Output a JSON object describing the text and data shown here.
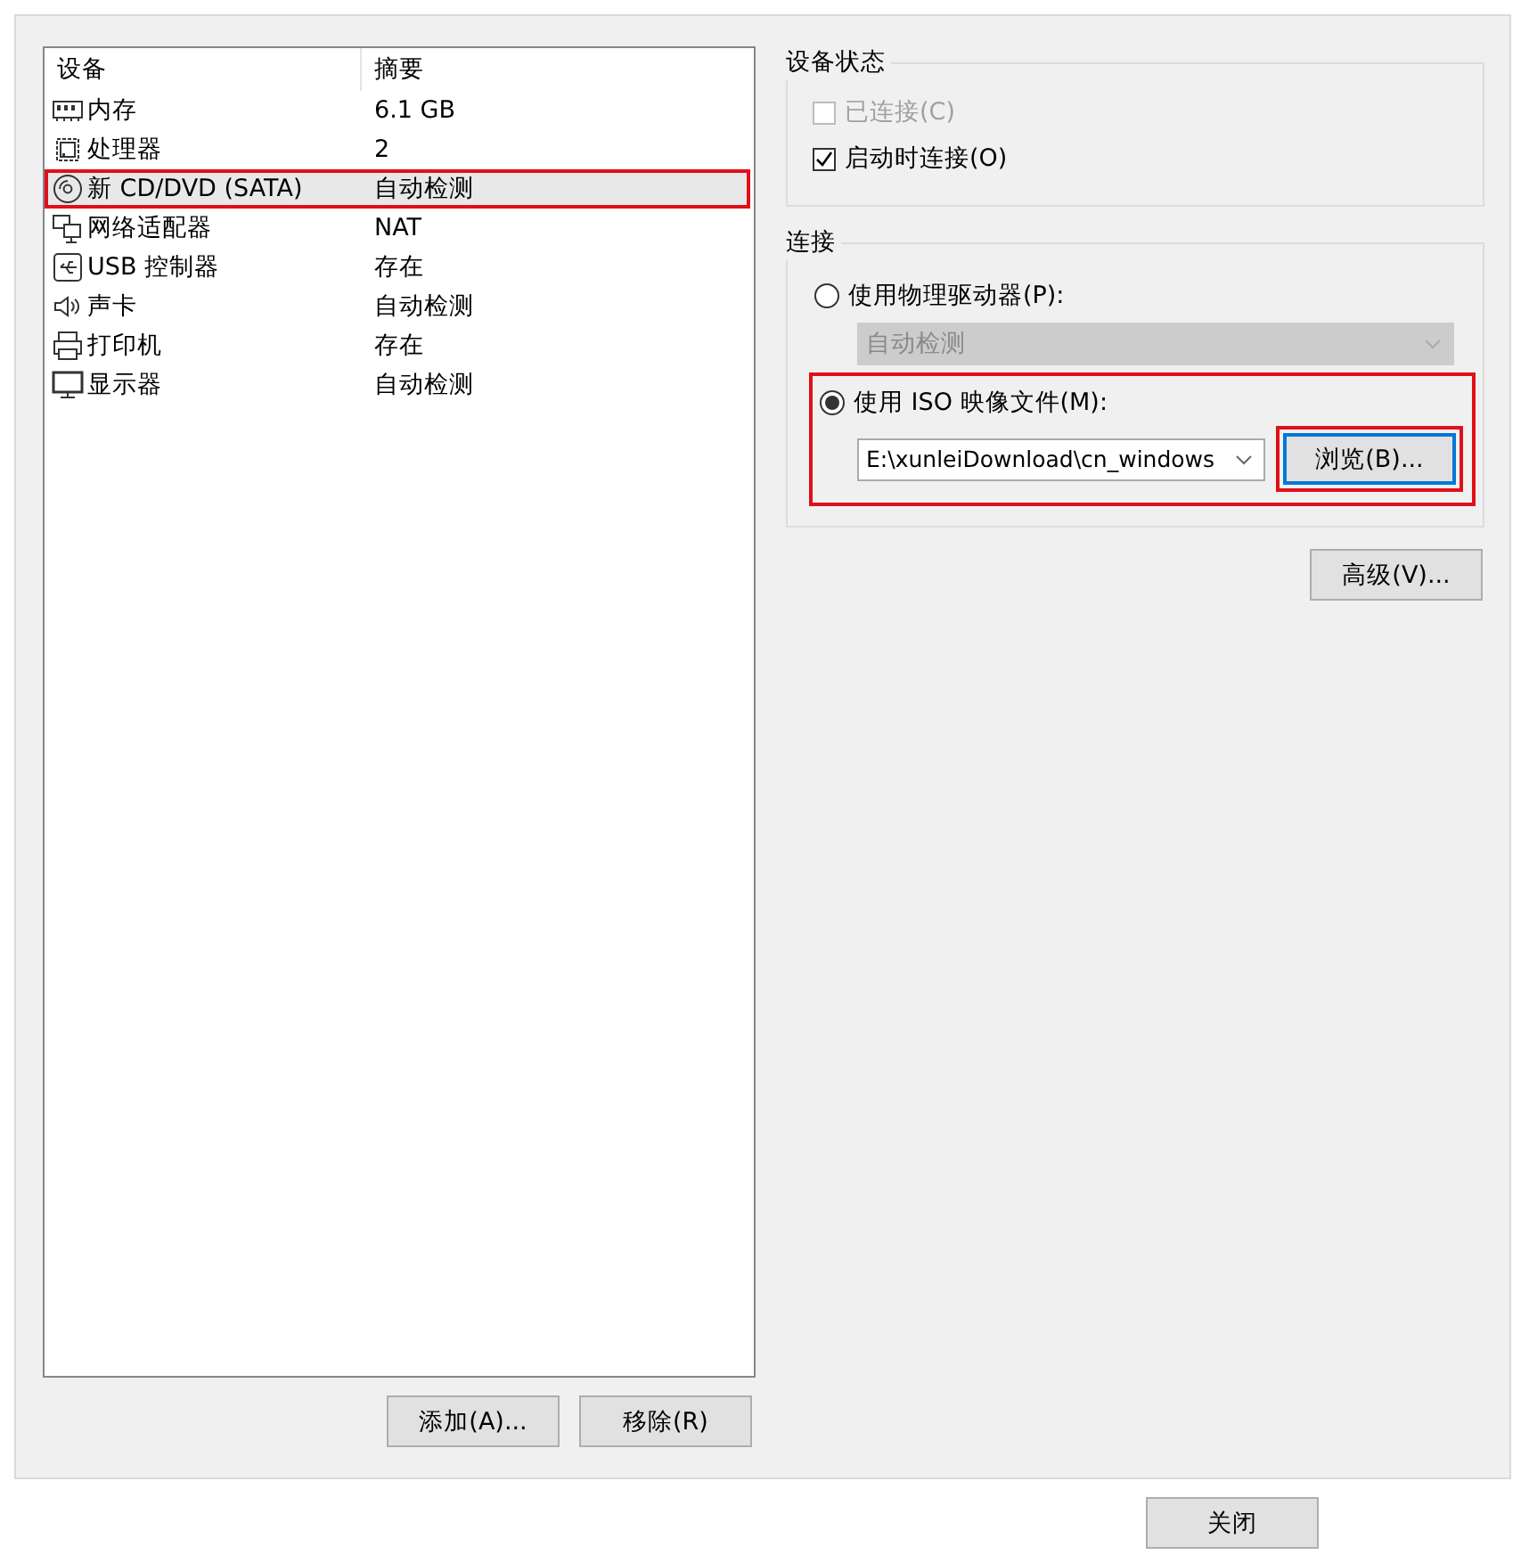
{
  "devices": {
    "columns": [
      "设备",
      "摘要"
    ],
    "rows": [
      {
        "kind": "memory",
        "name": "内存",
        "summary": "6.1 GB",
        "selected": false,
        "annotated": false
      },
      {
        "kind": "cpu",
        "name": "处理器",
        "summary": "2",
        "selected": false,
        "annotated": false
      },
      {
        "kind": "disc",
        "name": "新 CD/DVD (SATA)",
        "summary": "自动检测",
        "selected": true,
        "annotated": true
      },
      {
        "kind": "network",
        "name": "网络适配器",
        "summary": "NAT",
        "selected": false,
        "annotated": false
      },
      {
        "kind": "usb",
        "name": "USB 控制器",
        "summary": "存在",
        "selected": false,
        "annotated": false
      },
      {
        "kind": "sound",
        "name": "声卡",
        "summary": "自动检测",
        "selected": false,
        "annotated": false
      },
      {
        "kind": "printer",
        "name": "打印机",
        "summary": "存在",
        "selected": false,
        "annotated": false
      },
      {
        "kind": "display",
        "name": "显示器",
        "summary": "自动检测",
        "selected": false,
        "annotated": false
      }
    ]
  },
  "list_buttons": [
    "添加(A)...",
    "移除(R)"
  ],
  "device_status": {
    "title": "设备状态",
    "options": [
      {
        "label": "已连接(C)",
        "checked": false,
        "disabled": true
      },
      {
        "label": "启动时连接(O)",
        "checked": true,
        "disabled": false
      }
    ]
  },
  "connection": {
    "title": "连接",
    "physical": {
      "label": "使用物理驱动器(P):",
      "selected": false,
      "value": "自动检测",
      "disabled": true
    },
    "iso": {
      "label": "使用 ISO 映像文件(M):",
      "selected": true,
      "annotated": true,
      "value": "E:\\xunleiDownload\\cn_windows",
      "browse": {
        "label": "浏览(B)...",
        "annotated": true,
        "focused": true
      }
    }
  },
  "advanced_button": "高级(V)...",
  "footer_buttons": [
    "关闭"
  ]
}
